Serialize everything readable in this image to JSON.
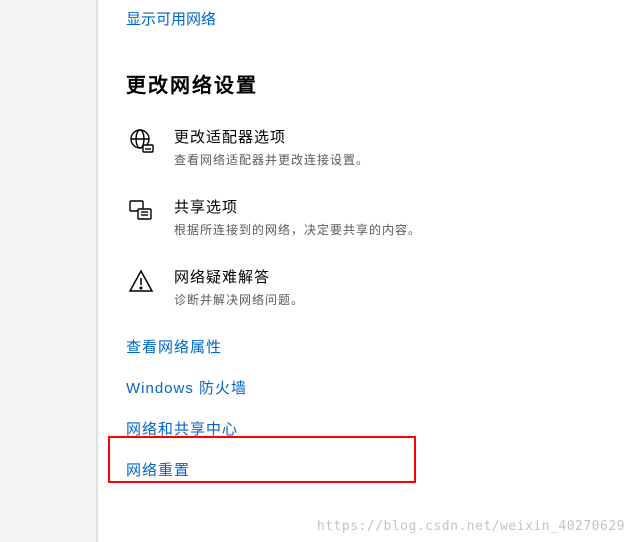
{
  "top_link": "显示可用网络",
  "section_title": "更改网络设置",
  "settings": [
    {
      "icon": "globe-ethernet-icon",
      "label": "更改适配器选项",
      "desc": "查看网络适配器并更改连接设置。"
    },
    {
      "icon": "sharing-icon",
      "label": "共享选项",
      "desc": "根据所连接到的网络，决定要共享的内容。"
    },
    {
      "icon": "warning-triangle-icon",
      "label": "网络疑难解答",
      "desc": "诊断并解决网络问题。"
    }
  ],
  "links": [
    "查看网络属性",
    "Windows 防火墙",
    "网络和共享中心",
    "网络重置"
  ],
  "watermark": "https://blog.csdn.net/weixin_40270629"
}
